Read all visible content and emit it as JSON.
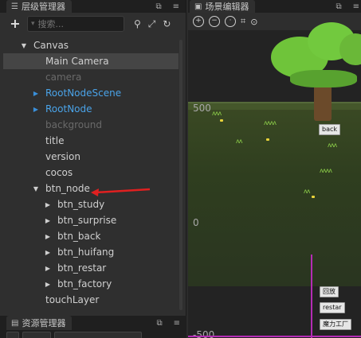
{
  "hierarchy": {
    "tab_title": "层级管理器",
    "search_placeholder": "搜索...",
    "rows": [
      {
        "label": "Canvas",
        "indent": 0,
        "arrow": "down",
        "style": "norm"
      },
      {
        "label": "Main Camera",
        "indent": 1,
        "arrow": "none",
        "style": "norm",
        "selected": true
      },
      {
        "label": "camera",
        "indent": 1,
        "arrow": "none",
        "style": "dim"
      },
      {
        "label": "RootNodeScene",
        "indent": 1,
        "arrow": "right-blue",
        "style": "prefab"
      },
      {
        "label": "RootNode",
        "indent": 1,
        "arrow": "right-blue",
        "style": "prefab"
      },
      {
        "label": "background",
        "indent": 1,
        "arrow": "none",
        "style": "dim"
      },
      {
        "label": "title",
        "indent": 1,
        "arrow": "none",
        "style": "norm"
      },
      {
        "label": "version",
        "indent": 1,
        "arrow": "none",
        "style": "norm"
      },
      {
        "label": "cocos",
        "indent": 1,
        "arrow": "none",
        "style": "norm"
      },
      {
        "label": "btn_node",
        "indent": 1,
        "arrow": "down",
        "style": "norm"
      },
      {
        "label": "btn_study",
        "indent": 2,
        "arrow": "right",
        "style": "norm"
      },
      {
        "label": "btn_surprise",
        "indent": 2,
        "arrow": "right",
        "style": "norm"
      },
      {
        "label": "btn_back",
        "indent": 2,
        "arrow": "right",
        "style": "norm"
      },
      {
        "label": "btn_huifang",
        "indent": 2,
        "arrow": "right",
        "style": "norm"
      },
      {
        "label": "btn_restar",
        "indent": 2,
        "arrow": "right",
        "style": "norm"
      },
      {
        "label": "btn_factory",
        "indent": 2,
        "arrow": "right",
        "style": "norm"
      },
      {
        "label": "touchLayer",
        "indent": 1,
        "arrow": "none",
        "style": "norm"
      }
    ]
  },
  "assets": {
    "tab_title": "资源管理器"
  },
  "scene": {
    "tab_title": "场景编辑器",
    "coord_500": "500",
    "coord_0": "0",
    "coord_neg500": "-500",
    "buttons": {
      "back": "back",
      "huifang": "回放",
      "restar": "restar",
      "factory": "魔力工厂"
    }
  },
  "colors": {
    "prefab_blue": "#4aa3e8",
    "selection": "#454545",
    "annotation_red": "#e02020",
    "axis_magenta": "#b52bb5"
  }
}
